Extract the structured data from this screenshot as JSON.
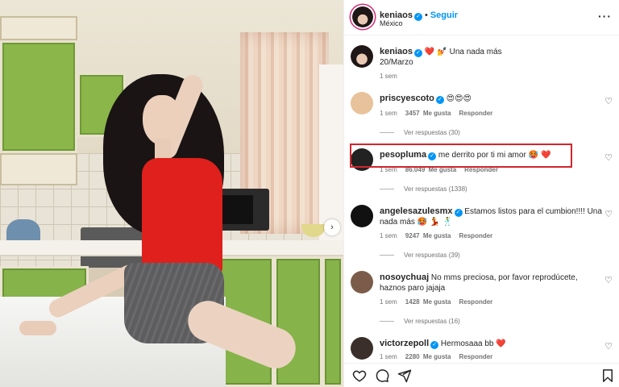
{
  "post": {
    "author": "keniaos",
    "follow_label": "Seguir",
    "separator": "•",
    "location": "México",
    "caption_text": "Una nada más",
    "caption_emojis_before": "❤️ 💅",
    "caption_line2": "20/Marzo",
    "time": "1 sem"
  },
  "labels": {
    "likes_suffix": "Me gusta",
    "reply": "Responder"
  },
  "comments": [
    {
      "user": "priscyescoto",
      "verified": true,
      "text": "😍😍😍",
      "time": "1 sem",
      "likes": "3457",
      "replies_label": "Ver respuestas (30)"
    },
    {
      "user": "pesopluma",
      "verified": true,
      "text": "me derrito por ti mi amor",
      "emojis": "🥵 ❤️",
      "time": "1 sem",
      "likes": "86.049",
      "replies_label": "Ver respuestas (1338)"
    },
    {
      "user": "angelesazulesmx",
      "verified": true,
      "text": "Estamos listos para el cumbion!!!! Una nada más",
      "emojis": "🥵 💃 🕺",
      "time": "1 sem",
      "likes": "9247",
      "replies_label": "Ver respuestas (39)"
    },
    {
      "user": "nosoychuaj",
      "verified": false,
      "text": "No mms preciosa, por favor reprodúcete, haznos paro jajaja",
      "time": "1 sem",
      "likes": "1428",
      "replies_label": "Ver respuestas (16)"
    },
    {
      "user": "victorzepoll",
      "verified": true,
      "text": "Hermosaaa bb",
      "emojis": "❤️",
      "time": "1 sem",
      "likes": "2280"
    }
  ],
  "icons": {
    "more": "more-options-icon",
    "verified": "verified-badge-icon",
    "heart": "heart-icon",
    "comment": "comment-icon",
    "share": "share-icon",
    "save": "bookmark-icon",
    "next": "chevron-right-icon"
  },
  "colors": {
    "accent_blue": "#0095f6",
    "highlight_red": "#d0262d",
    "muted_text": "#737373"
  }
}
